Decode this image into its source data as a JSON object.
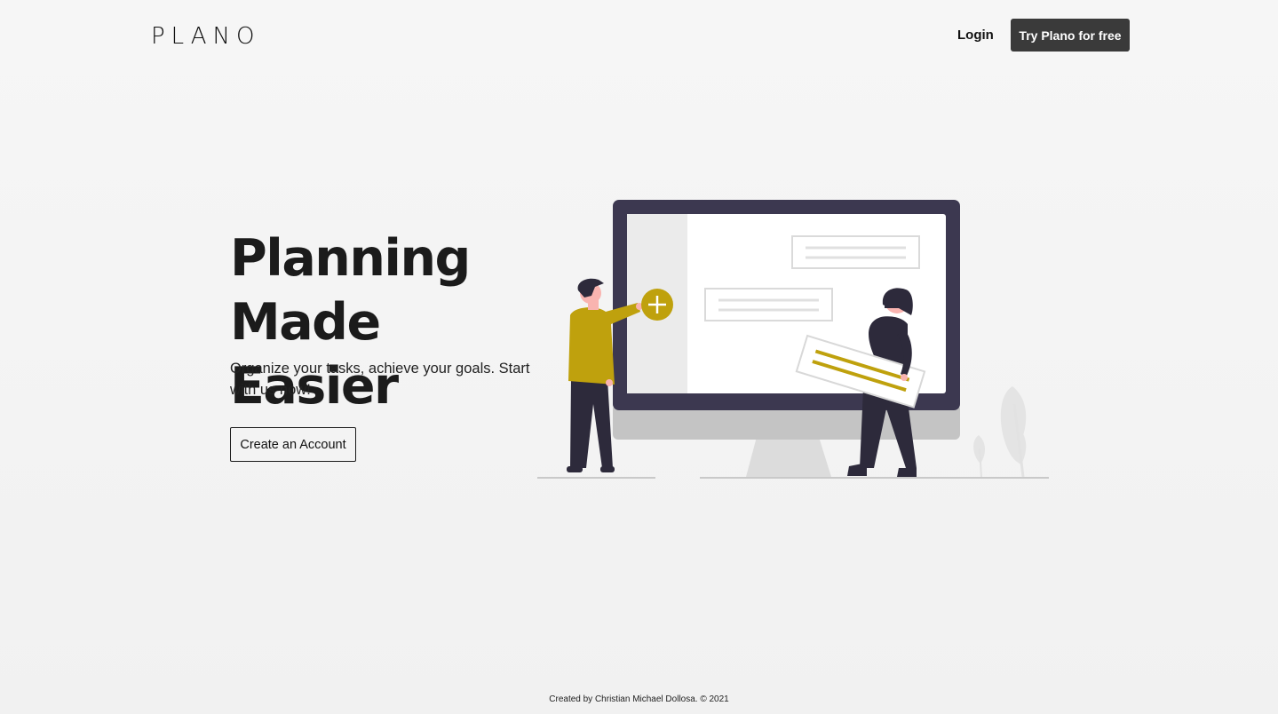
{
  "header": {
    "logo": "PLANO",
    "login_label": "Login",
    "cta_label": "Try Plano for free"
  },
  "hero": {
    "title_line1": "Planning",
    "title_line2": "Made Easier",
    "subtitle": "Organize your tasks, achieve your goals. Start with us now!",
    "button_label": "Create an Account"
  },
  "illustration": {
    "accent_color": "#bfa10d",
    "monitor_color": "#3c3850",
    "icons": [
      "plus-icon"
    ]
  },
  "footer": {
    "credit": "Created by Christian Michael Dollosa. © 2021"
  }
}
